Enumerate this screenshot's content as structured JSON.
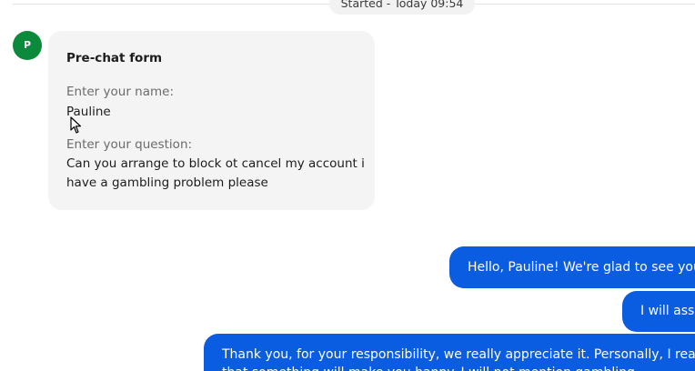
{
  "divider": {
    "label": "Started - Today 09:54"
  },
  "agent_avatar": {
    "initial": "P",
    "color": "#0b8a3c"
  },
  "pre_chat_form": {
    "title": "Pre-chat form",
    "fields": [
      {
        "label": "Enter your name:",
        "value": "Pauline"
      },
      {
        "label": "Enter your question:",
        "value": "Can you arrange to block ot cancel my account i have a gambling problem please"
      }
    ]
  },
  "outgoing_messages": [
    {
      "text": "Hello, Pauline! We're glad to see you i"
    },
    {
      "text": "I will assi"
    },
    {
      "lines": [
        "Thank you, for your responsibility, we really appreciate it. Personally, I really ho",
        "that something will make you happy. I will not mention gambling"
      ]
    }
  ],
  "colors": {
    "outgoing_bubble": "#0a5ce0",
    "form_card": "#f4f4f4",
    "divider_pill": "#f2f2f2"
  }
}
